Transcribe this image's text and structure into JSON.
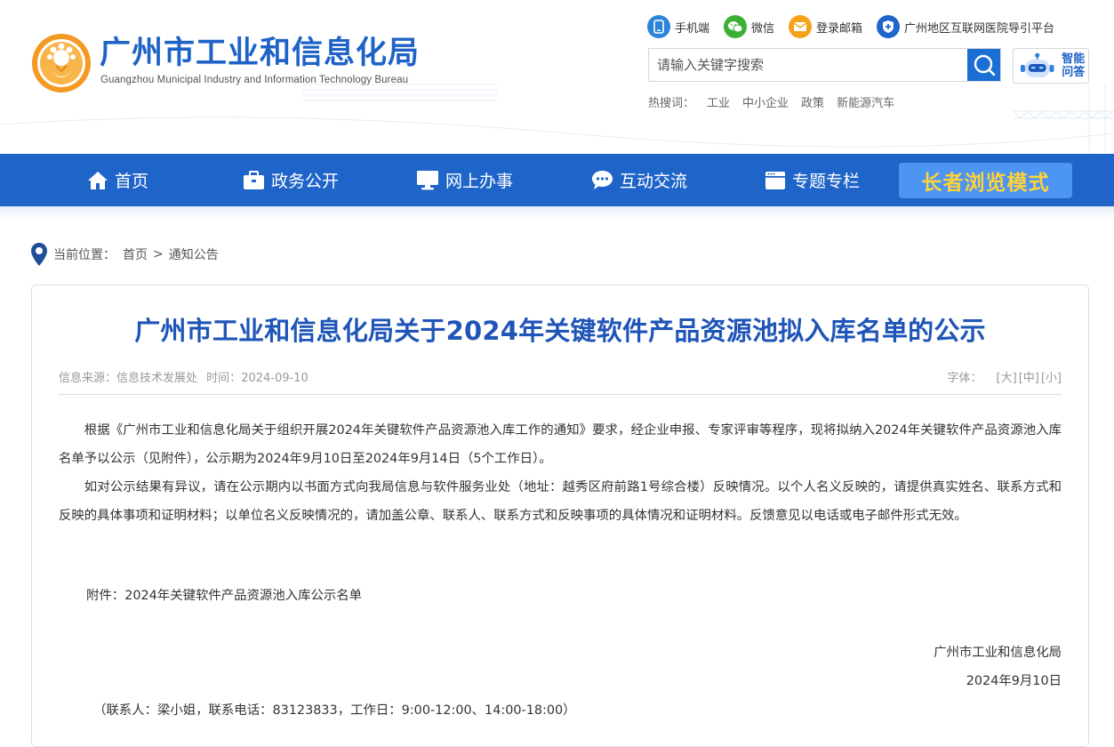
{
  "header": {
    "title": "广州市工业和信息化局",
    "subtitle": "Guangzhou Municipal Industry and Information Technology Bureau",
    "top_links": [
      {
        "label": "手机端",
        "icon": "mobile-icon",
        "color": "#2c84d8"
      },
      {
        "label": "微信",
        "icon": "wechat-icon",
        "color": "#3cb035"
      },
      {
        "label": "登录邮箱",
        "icon": "mail-icon",
        "color": "#f5a21b"
      },
      {
        "label": "广州地区互联网医院导引平台",
        "icon": "shield-icon",
        "color": "#1f64c9"
      }
    ],
    "search": {
      "placeholder": "请输入关键字搜索",
      "value": ""
    },
    "ai_assistant": {
      "label_line1": "智能",
      "label_line2": "问答"
    },
    "hot": {
      "label": "热搜词：",
      "keywords": [
        "工业",
        "中小企业",
        "政策",
        "新能源汽车"
      ]
    }
  },
  "nav": {
    "items": [
      {
        "label": "首页",
        "icon": "home-icon"
      },
      {
        "label": "政务公开",
        "icon": "briefcase-icon"
      },
      {
        "label": "网上办事",
        "icon": "monitor-icon"
      },
      {
        "label": "互动交流",
        "icon": "chat-icon"
      },
      {
        "label": "专题专栏",
        "icon": "window-icon"
      }
    ],
    "elder_mode": "长者浏览模式"
  },
  "breadcrumb": {
    "label": "当前位置：",
    "items": [
      "首页",
      "通知公告"
    ],
    "separator": ">"
  },
  "article": {
    "title": "广州市工业和信息化局关于2024年关键软件产品资源池拟入库名单的公示",
    "source_label": "信息来源：",
    "source": "信息技术发展处",
    "time_label": "时间：",
    "time": "2024-09-10",
    "font_label": "字体：",
    "font_sizes": [
      "[大]",
      "[中]",
      "[小]"
    ],
    "paragraphs": [
      "根据《广州市工业和信息化局关于组织开展2024年关键软件产品资源池入库工作的通知》要求，经企业申报、专家评审等程序，现将拟纳入2024年关键软件产品资源池入库名单予以公示（见附件），公示期为2024年9月10日至2024年9月14日（5个工作日）。",
      "如对公示结果有异议，请在公示期内以书面方式向我局信息与软件服务业处（地址：越秀区府前路1号综合楼）反映情况。以个人名义反映的，请提供真实姓名、联系方式和反映的具体事项和证明材料；以单位名义反映情况的，请加盖公章、联系人、联系方式和反映事项的具体情况和证明材料。反馈意见以电话或电子邮件形式无效。"
    ],
    "attachment_label": "附件：",
    "attachment": "2024年关键软件产品资源池入库公示名单",
    "signature_org": "广州市工业和信息化局",
    "signature_date": "2024年9月10日",
    "contact": "（联系人：梁小姐，联系电话：83123833，工作日：9:00-12:00、14:00-18:00）"
  },
  "colors": {
    "brand_blue": "#1f64c9",
    "title_blue": "#1f55b8",
    "elder_button": "#4c95f2",
    "elder_text": "#ffd23a"
  }
}
